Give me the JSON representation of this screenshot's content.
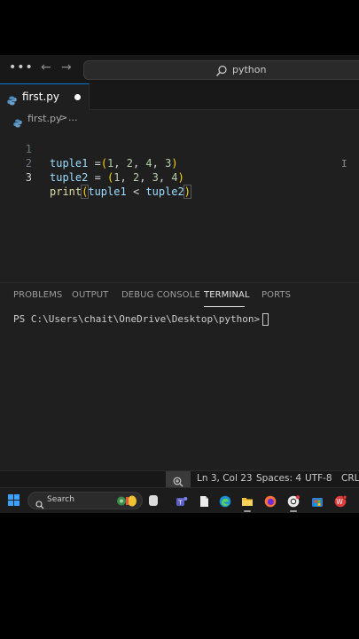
{
  "title_bar": {
    "menu_icon": "more-horizontal-icon",
    "back_icon": "arrow-left-icon",
    "forward_icon": "arrow-right-icon",
    "search_icon": "search-icon",
    "command_center_text": "python"
  },
  "tabs": [
    {
      "label": "first.py",
      "icon": "python-file-icon",
      "modified": true,
      "active": true
    }
  ],
  "breadcrumb": {
    "file": "first.py",
    "separator": ">",
    "more": "..."
  },
  "editor": {
    "line_numbers": [
      "1",
      "2",
      "3"
    ],
    "lines": [
      {
        "t1": "tuple1",
        "t2": " =",
        "t3": "(",
        "t4": "1",
        "t5": ", ",
        "t6": "2",
        "t7": ", ",
        "t8": "4",
        "t9": ", ",
        "t10": "3",
        "t11": ")"
      },
      {
        "t1": "tuple2",
        "t2": " = ",
        "t3": "(",
        "t4": "1",
        "t5": ", ",
        "t6": "2",
        "t7": ", ",
        "t8": "3",
        "t9": ", ",
        "t10": "4",
        "t11": ")"
      },
      {
        "t1": "print",
        "t2": "(",
        "t3": "tuple1",
        "t4": " < ",
        "t5": "tuple2",
        "t6": ")"
      }
    ],
    "current_line": 3
  },
  "panel": {
    "tabs": [
      "PROBLEMS",
      "OUTPUT",
      "DEBUG CONSOLE",
      "TERMINAL",
      "PORTS"
    ],
    "active_tab": "TERMINAL",
    "terminal_prompt": "PS C:\\Users\\chait\\OneDrive\\Desktop\\python>"
  },
  "status_bar": {
    "zoom_icon": "zoom-icon",
    "position": "Ln 3, Col 23",
    "indent": "Spaces: 4",
    "encoding": "UTF-8",
    "eol": "CRLF"
  },
  "taskbar": {
    "search_placeholder": "Search",
    "icons": [
      "windows-start-icon",
      "copilot-icon",
      "task-view-icon",
      "teams-icon",
      "file-icon",
      "edge-icon",
      "file-explorer-icon",
      "firefox-icon",
      "chrome-icon",
      "store-icon",
      "wps-office-icon"
    ]
  },
  "colors": {
    "accent": "#0078d4",
    "editor_bg": "#1f1f1f",
    "chrome_bg": "#181818",
    "variable": "#9cdcfe",
    "number": "#b5cea8",
    "function": "#dcdcaa",
    "bracket1": "#ffd700",
    "bracket2": "#da70d6"
  }
}
